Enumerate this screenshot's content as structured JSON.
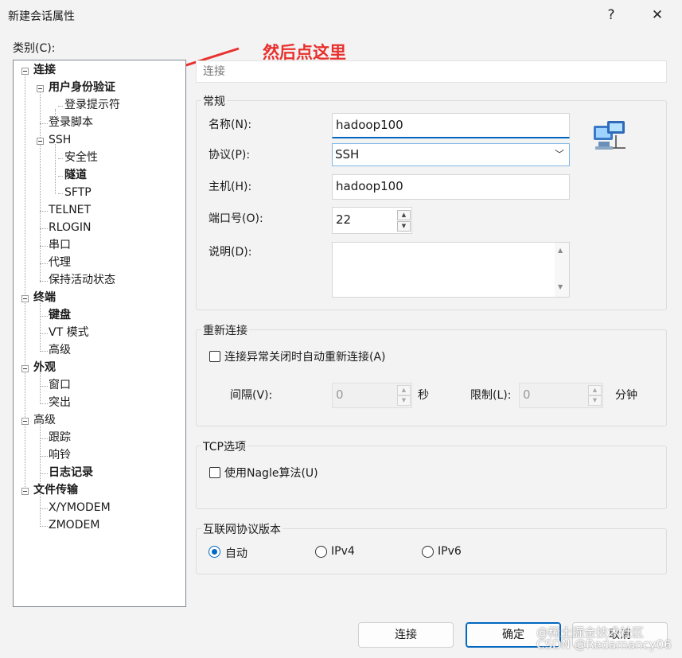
{
  "window": {
    "title": "新建会话属性",
    "help": "?",
    "close": "✕"
  },
  "category_label": "类别(C):",
  "annotation": "然后点这里",
  "tree": {
    "items": [
      {
        "label": "连接",
        "bold": true
      },
      {
        "label": "用户身份验证",
        "bold": true
      },
      {
        "label": "登录提示符",
        "bold": false
      },
      {
        "label": "登录脚本",
        "bold": false
      },
      {
        "label": "SSH",
        "bold": false
      },
      {
        "label": "安全性",
        "bold": false
      },
      {
        "label": "隧道",
        "bold": true
      },
      {
        "label": "SFTP",
        "bold": false
      },
      {
        "label": "TELNET",
        "bold": false
      },
      {
        "label": "RLOGIN",
        "bold": false
      },
      {
        "label": "串口",
        "bold": false
      },
      {
        "label": "代理",
        "bold": false
      },
      {
        "label": "保持活动状态",
        "bold": false
      },
      {
        "label": "终端",
        "bold": true
      },
      {
        "label": "键盘",
        "bold": true
      },
      {
        "label": "VT 模式",
        "bold": false
      },
      {
        "label": "高级",
        "bold": false
      },
      {
        "label": "外观",
        "bold": true
      },
      {
        "label": "窗口",
        "bold": false
      },
      {
        "label": "突出",
        "bold": false
      },
      {
        "label": "高级",
        "bold": false
      },
      {
        "label": "跟踪",
        "bold": false
      },
      {
        "label": "响铃",
        "bold": false
      },
      {
        "label": "日志记录",
        "bold": true
      },
      {
        "label": "文件传输",
        "bold": true
      },
      {
        "label": "X/YMODEM",
        "bold": false
      },
      {
        "label": "ZMODEM",
        "bold": false
      }
    ]
  },
  "section_title": "连接",
  "general": {
    "label": "常规",
    "name_label": "名称(N):",
    "name_value": "hadoop100",
    "protocol_label": "协议(P):",
    "protocol_value": "SSH",
    "host_label": "主机(H):",
    "host_value": "hadoop100",
    "port_label": "端口号(O):",
    "port_value": "22",
    "desc_label": "说明(D):",
    "desc_value": "",
    "icon": "network-computer-icon"
  },
  "reconnect": {
    "label": "重新连接",
    "checkbox_label": "连接异常关闭时自动重新连接(A)",
    "checked": false,
    "interval_label": "间隔(V):",
    "interval_value": "0",
    "interval_unit": "秒",
    "limit_label": "限制(L):",
    "limit_value": "0",
    "limit_unit": "分钟"
  },
  "tcp": {
    "label": "TCP选项",
    "nagle_label": "使用Nagle算法(U)",
    "checked": false
  },
  "ip_version": {
    "label": "互联网协议版本",
    "options": [
      "自动",
      "IPv4",
      "IPv6"
    ],
    "selected": "自动"
  },
  "buttons": {
    "connect": "连接",
    "ok": "确定",
    "cancel": "取消"
  },
  "watermark": {
    "line1": "@稀土掘金技术社区",
    "line2": "CSDN @Redamancy06"
  },
  "colors": {
    "accent": "#0067c0",
    "annotation": "#e8312e"
  }
}
